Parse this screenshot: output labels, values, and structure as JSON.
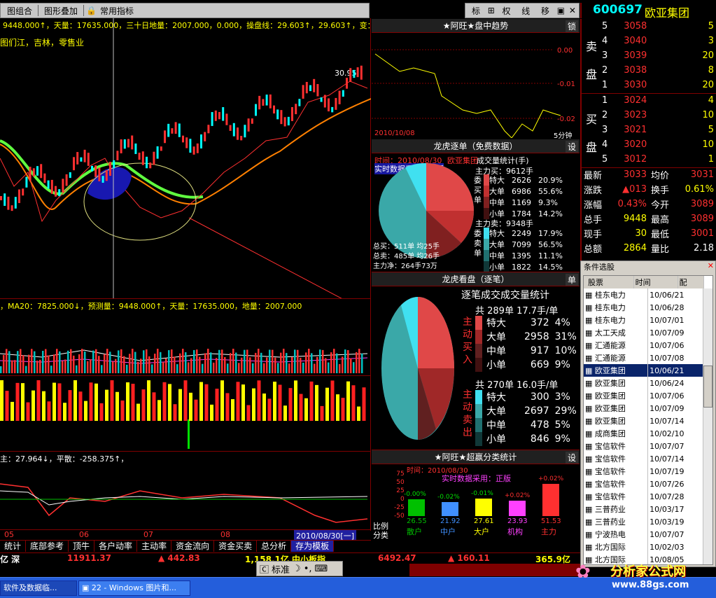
{
  "toolbar": {
    "b1": "图组合",
    "b2": "图形叠加",
    "b3": "常用指标",
    "r1": "标",
    "r2": "权",
    "r3": "线",
    "r4": "移"
  },
  "stock": {
    "code": "600697",
    "name": "欧亚集团"
  },
  "kline": {
    "info": "9448.000↑，天量：17635.000，三十日地量：2007.000，0.000，操盘线：29.603↑，29.603↑，变：30.",
    "sector": "图们江，吉林，零售业",
    "price_label": "30.95"
  },
  "vol": {
    "info": "，MA20：7825.000↓，预测量：9448.000↑，天量：17635.000，地量：2007.000"
  },
  "ind": {
    "info": "主：27.964↓，平散：-258.375↑，"
  },
  "xaxis": [
    "05",
    "06",
    "07",
    "08"
  ],
  "date_label": "2010/08/30[一]",
  "trend": {
    "title": "★阿旺★盘中趋势",
    "btn": "锁",
    "yticks": [
      "0.00",
      "-0.01",
      "-0.02"
    ],
    "date": "2010/10/08",
    "period": "5分钟"
  },
  "dragon1": {
    "title": "龙虎逐单（免费数据）",
    "btn": "设",
    "time": "时间：2010/08/30",
    "name": "欧亚集团",
    "src": "实时数据采用：正版",
    "stat_title": "成交量统计(手)",
    "buy_total": "主力买：9612手",
    "sell_total": "主力卖：9348手",
    "side_buy": "委买单",
    "side_sell": "委卖单",
    "buy": [
      {
        "k": "特大",
        "v": "2626",
        "p": "20.9%"
      },
      {
        "k": "大单",
        "v": "6986",
        "p": "55.6%"
      },
      {
        "k": "中单",
        "v": "1169",
        "p": "9.3%"
      },
      {
        "k": "小单",
        "v": "1784",
        "p": "14.2%"
      }
    ],
    "sell": [
      {
        "k": "特大",
        "v": "2249",
        "p": "17.9%"
      },
      {
        "k": "大单",
        "v": "7099",
        "p": "56.5%"
      },
      {
        "k": "中单",
        "v": "1395",
        "p": "11.1%"
      },
      {
        "k": "小单",
        "v": "1822",
        "p": "14.5%"
      }
    ],
    "tb": "总买：511单 均25手",
    "ts": "总卖：485单 均26手",
    "net": "主力净：264手73万"
  },
  "dragon2": {
    "title": "龙虎看盘（逐笔）",
    "btn": "单",
    "stat": "逐笔成交成交量统计",
    "buy_head": "共 289单 17.7手/单",
    "sell_head": "共 270单 16.0手/单",
    "buy_side": "主动买入",
    "sell_side": "主动卖出",
    "buy": [
      {
        "k": "特大",
        "v": "372",
        "p": "4%"
      },
      {
        "k": "大单",
        "v": "2958",
        "p": "31%"
      },
      {
        "k": "中单",
        "v": "917",
        "p": "10%"
      },
      {
        "k": "小单",
        "v": "669",
        "p": "9%"
      }
    ],
    "sell": [
      {
        "k": "特大",
        "v": "300",
        "p": "3%"
      },
      {
        "k": "大单",
        "v": "2697",
        "p": "29%"
      },
      {
        "k": "中单",
        "v": "478",
        "p": "5%"
      },
      {
        "k": "小单",
        "v": "846",
        "p": "9%"
      }
    ]
  },
  "super": {
    "title": "★阿旺★超赢分类统计",
    "btn": "设",
    "time": "时间：2010/08/30",
    "src": "实时数据采用：正版",
    "yticks": [
      "75",
      "50",
      "25",
      "0",
      "-25",
      "-50"
    ],
    "l1": "比例",
    "l2": "分类",
    "bars": [
      {
        "pct": "-0.00%",
        "val": "26.55",
        "cat": "散户",
        "c": "#00c000"
      },
      {
        "pct": "-0.02%",
        "val": "21.92",
        "cat": "中户",
        "c": "#4090ff"
      },
      {
        "pct": "-0.01%",
        "val": "27.61",
        "cat": "大户",
        "c": "#ffff00"
      },
      {
        "pct": "+0.02%",
        "val": "23.93",
        "cat": "机构",
        "c": "#ff40ff"
      },
      {
        "pct": "+0.02%",
        "val": "51.53",
        "cat": "主力",
        "c": "#ff3030"
      }
    ]
  },
  "quotes": {
    "sell_label": "卖盘",
    "buy_label": "买盘",
    "sell": [
      {
        "n": "5",
        "p": "3058",
        "v": "5"
      },
      {
        "n": "4",
        "p": "3040",
        "v": "3"
      },
      {
        "n": "3",
        "p": "3039",
        "v": "20"
      },
      {
        "n": "2",
        "p": "3038",
        "v": "8"
      },
      {
        "n": "1",
        "p": "3030",
        "v": "20"
      }
    ],
    "buy": [
      {
        "n": "1",
        "p": "3024",
        "v": "4"
      },
      {
        "n": "2",
        "p": "3023",
        "v": "10"
      },
      {
        "n": "3",
        "p": "3021",
        "v": "5"
      },
      {
        "n": "4",
        "p": "3020",
        "v": "10"
      },
      {
        "n": "5",
        "p": "3012",
        "v": "1"
      }
    ],
    "stats": [
      [
        "最新",
        "3033",
        "均价",
        "3031"
      ],
      [
        "涨跌",
        "▲013",
        "换手",
        "0.61%"
      ],
      [
        "涨幅",
        "0.43%",
        "今开",
        "3089"
      ],
      [
        "总手",
        "9448",
        "最高",
        "3089"
      ],
      [
        "现手",
        "30",
        "最低",
        "3001"
      ],
      [
        "总额",
        "2864",
        "量比",
        "2.18"
      ]
    ]
  },
  "picker": {
    "title": "条件选股",
    "h1": "股票",
    "h2": "时间",
    "h3": "配",
    "rows": [
      [
        "桂东电力",
        "10/06/21"
      ],
      [
        "桂东电力",
        "10/06/28"
      ],
      [
        "桂东电力",
        "10/07/01"
      ],
      [
        "太工天成",
        "10/07/09"
      ],
      [
        "汇通能源",
        "10/07/06"
      ],
      [
        "汇通能源",
        "10/07/08"
      ],
      [
        "欧亚集团",
        "10/06/21"
      ],
      [
        "欧亚集团",
        "10/06/24"
      ],
      [
        "欧亚集团",
        "10/07/06"
      ],
      [
        "欧亚集团",
        "10/07/09"
      ],
      [
        "欧亚集团",
        "10/07/14"
      ],
      [
        "成商集团",
        "10/02/10"
      ],
      [
        "宝信软件",
        "10/07/07"
      ],
      [
        "宝信软件",
        "10/07/14"
      ],
      [
        "宝信软件",
        "10/07/19"
      ],
      [
        "宝信软件",
        "10/07/26"
      ],
      [
        "宝信软件",
        "10/07/28"
      ],
      [
        "三普药业",
        "10/03/17"
      ],
      [
        "三普药业",
        "10/03/19"
      ],
      [
        "宁波热电",
        "10/07/07"
      ],
      [
        "北方国际",
        "10/02/03"
      ],
      [
        "北方国际",
        "10/08/05"
      ]
    ]
  },
  "tabs": [
    "统计",
    "底部参考",
    "顶牛",
    "各户动率",
    "主动率",
    "资金流向",
    "资金买卖",
    "总分析",
    "存为模板"
  ],
  "ticker": {
    "t1": "亿 深",
    "v1": "11911.37",
    "c1": "▲ 442.83",
    "v2": "1,158.1亿 中小板指",
    "v3": "6492.47",
    "c3": "▲ 160.11",
    "v4": "365.9亿"
  },
  "ime": {
    "mode": "标准"
  },
  "taskbar": {
    "t1": "软件及数据临...",
    "t2": "22 - Windows 图片和..."
  },
  "logo": {
    "text": "分析家公式网",
    "url": "www.88gs.com"
  }
}
